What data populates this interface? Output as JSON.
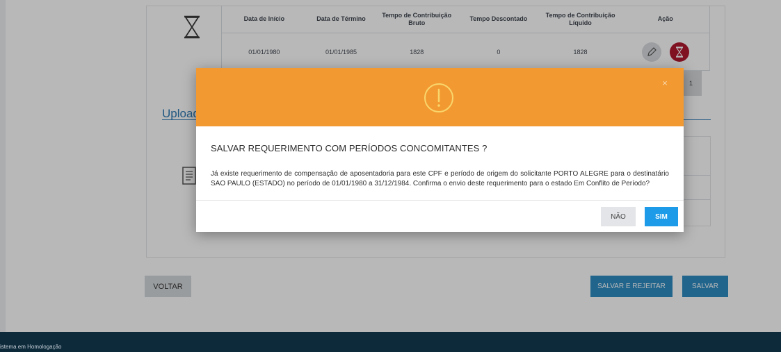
{
  "table": {
    "headers": [
      "Data de Início",
      "Data de Término",
      "Tempo de Contribuição Bruto",
      "Tempo Descontado",
      "Tempo de Contribuição Líquido",
      "Ação"
    ],
    "rows": [
      {
        "inicio": "01/01/1980",
        "termino": "01/01/1985",
        "bruto": "1828",
        "descontado": "0",
        "liquido": "1828"
      }
    ]
  },
  "pagination": {
    "current_page": "1"
  },
  "upload": {
    "title": "Upload"
  },
  "actions": {
    "voltar": "VOLTAR",
    "salvar_rejeitar": "SALVAR E REJEITAR",
    "salvar": "SALVAR"
  },
  "footer": {
    "text": "istema em Homologação"
  },
  "modal": {
    "title": "SALVAR REQUERIMENTO COM PERÍODOS CONCOMITANTES ?",
    "message": "Já existe requerimento de compensação de aposentadoria para este CPF e período de origem do solicitante PORTO ALEGRE para o destinatário SAO PAULO (ESTADO) no período de 01/01/1980 a 31/12/1984. Confirma o envio deste requerimento para o estado Em Conflito de Período?",
    "no_label": "NÃO",
    "yes_label": "SIM",
    "close_glyph": "×",
    "header_color": "#f29a31",
    "icon": "alert-circle-icon"
  },
  "colors": {
    "primary": "#2e8dc4",
    "confirm": "#1e9be8",
    "danger": "#b0182e",
    "footer": "#0d2a3b"
  }
}
